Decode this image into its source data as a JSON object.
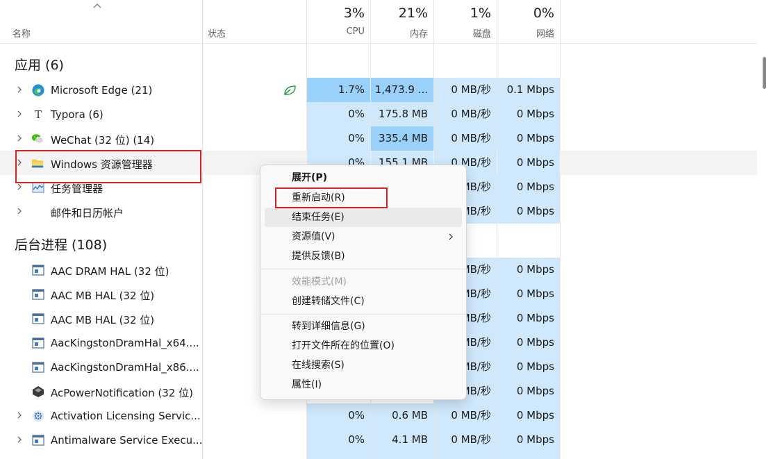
{
  "header": {
    "name_label": "名称",
    "status_label": "状态",
    "cpu_pct": "3%",
    "cpu_label": "CPU",
    "mem_pct": "21%",
    "mem_label": "内存",
    "disk_pct": "1%",
    "disk_label": "磁盘",
    "net_pct": "0%",
    "net_label": "网络"
  },
  "groups": {
    "apps": "应用 (6)",
    "background": "后台进程 (108)"
  },
  "apps": [
    {
      "name": "Microsoft Edge (21)",
      "cpu": "1.7%",
      "mem": "1,473.9 ...",
      "disk": "0 MB/秒",
      "net": "0.1 Mbps",
      "icon": "edge-icon"
    },
    {
      "name": "Typora (6)",
      "cpu": "0%",
      "mem": "175.8 MB",
      "disk": "0 MB/秒",
      "net": "0 Mbps",
      "icon": "typora-icon"
    },
    {
      "name": "WeChat (32 位) (14)",
      "cpu": "0%",
      "mem": "335.4 MB",
      "disk": "0 MB/秒",
      "net": "0 Mbps",
      "icon": "wechat-icon"
    },
    {
      "name": "Windows 资源管理器",
      "cpu": "0%",
      "mem": "155.1 MB",
      "disk": "0 MB/秒",
      "net": "0 Mbps",
      "icon": "folder-icon"
    },
    {
      "name": "任务管理器",
      "cpu": "",
      "mem": "",
      "disk": "MB/秒",
      "net": "0 Mbps",
      "icon": "taskmgr-icon"
    },
    {
      "name": "邮件和日历帐户",
      "cpu": "",
      "mem": "",
      "disk": "MB/秒",
      "net": "0 Mbps",
      "icon": ""
    }
  ],
  "background": [
    {
      "name": "AAC DRAM HAL (32 位)",
      "disk": "MB/秒",
      "net": "0 Mbps"
    },
    {
      "name": "AAC MB HAL (32 位)",
      "disk": "MB/秒",
      "net": "0 Mbps"
    },
    {
      "name": "AAC MB HAL (32 位)",
      "disk": "MB/秒",
      "net": "0 Mbps"
    },
    {
      "name": "AacKingstonDramHal_x64....",
      "disk": "MB/秒",
      "net": "0 Mbps"
    },
    {
      "name": "AacKingstonDramHal_x86....",
      "disk": "MB/秒",
      "net": "0 Mbps"
    },
    {
      "name": "AcPowerNotification (32 位)",
      "disk": "MB/秒",
      "net": "0 Mbps"
    },
    {
      "name": "Activation Licensing Servic...",
      "cpu": "0%",
      "mem": "0.6 MB",
      "disk": "0 MB/秒",
      "net": "0 Mbps"
    },
    {
      "name": "Antimalware Service Execu...",
      "cpu": "0%",
      "mem": "4.1 MB",
      "disk": "0 MB/秒",
      "net": "0 Mbps"
    }
  ],
  "menu": {
    "expand": "展开(P)",
    "restart": "重新启动(R)",
    "end_task": "结束任务(E)",
    "resource_values": "资源值(V)",
    "feedback": "提供反馈(B)",
    "efficiency": "效能模式(M)",
    "dump": "创建转储文件(C)",
    "details": "转到详细信息(G)",
    "open_location": "打开文件所在的位置(O)",
    "search_online": "在线搜索(S)",
    "properties": "属性(I)"
  }
}
